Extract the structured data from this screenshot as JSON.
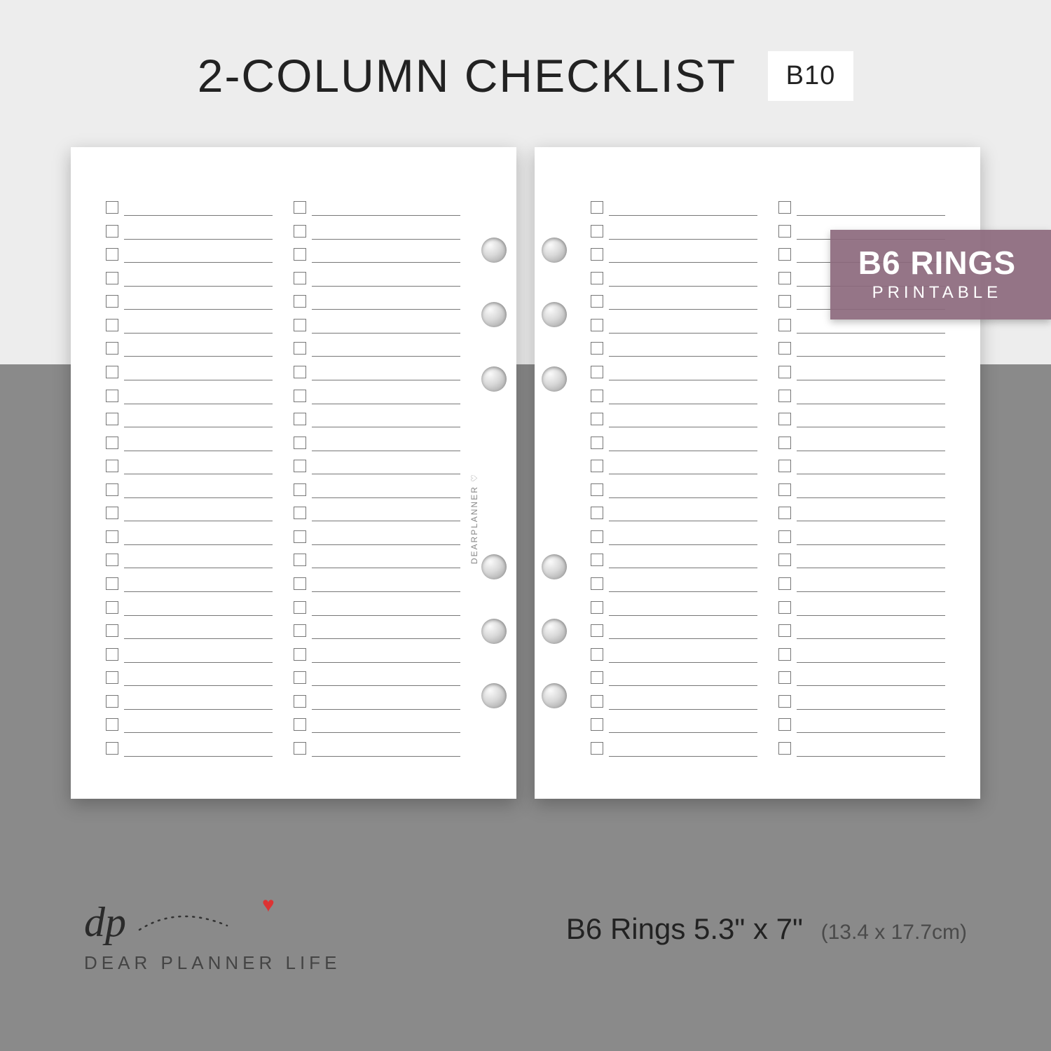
{
  "header": {
    "title": "2-COLUMN CHECKLIST",
    "code": "B10"
  },
  "ribbon": {
    "main": "B6 RINGS",
    "sub": "PRINTABLE"
  },
  "watermark": "DEARPLANNER ♡",
  "checklist": {
    "rows_per_column": 24,
    "columns_per_page": 2,
    "pages": 2
  },
  "footer": {
    "size_label": "B6 Rings 5.3\" x 7\"",
    "size_metric": "(13.4 x 17.7cm)"
  },
  "brand": {
    "initials": "dp",
    "name": "DEAR PLANNER LIFE"
  },
  "colors": {
    "ribbon": "#8c697d",
    "heart": "#d33"
  }
}
